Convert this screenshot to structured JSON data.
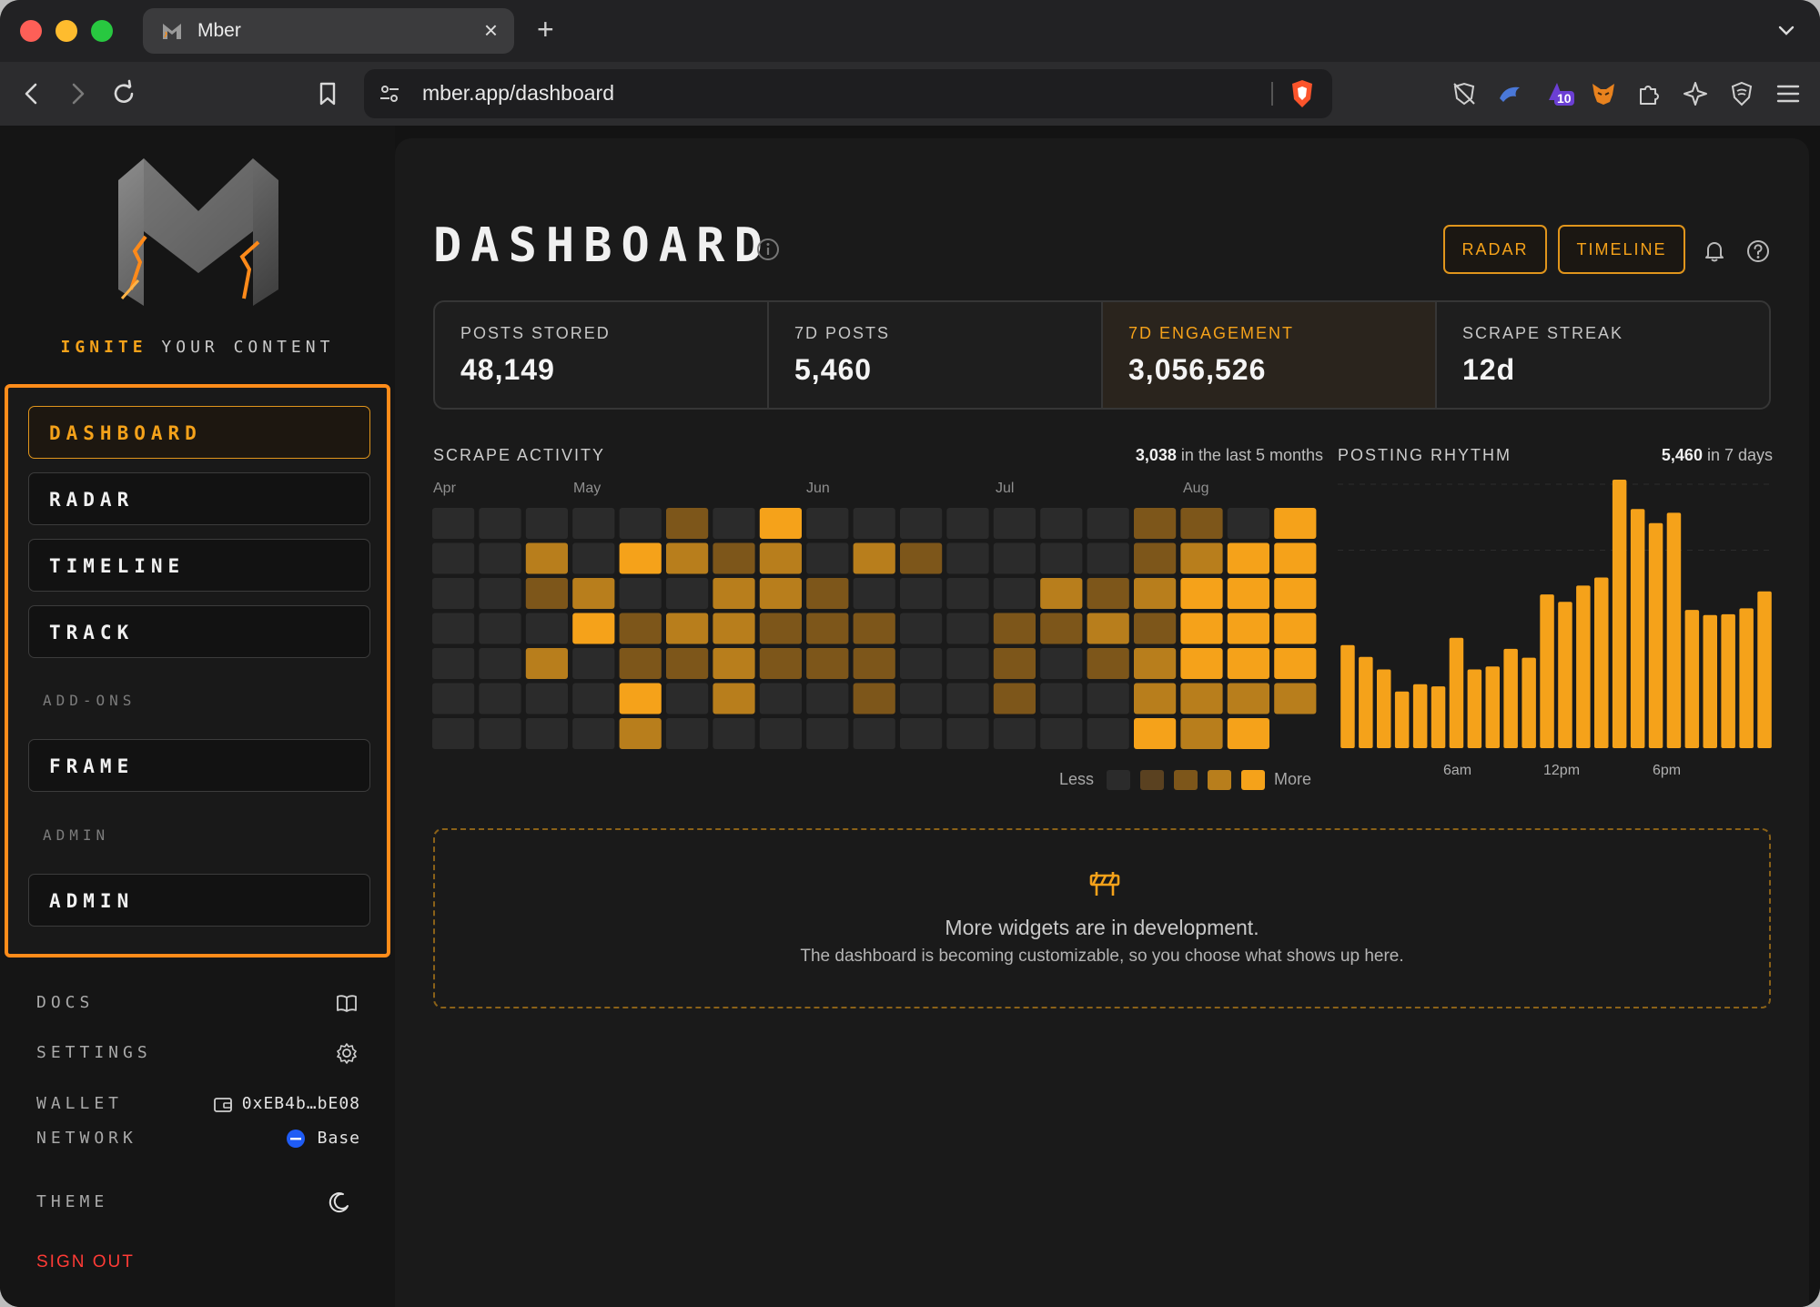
{
  "browser": {
    "tab_title": "Mber",
    "url": "mber.app/dashboard",
    "extension_badge": "10"
  },
  "sidebar": {
    "tagline_hot": "IGNITE",
    "tagline_rest": " YOUR CONTENT",
    "nav": [
      {
        "label": "DASHBOARD",
        "active": true
      },
      {
        "label": "RADAR"
      },
      {
        "label": "TIMELINE"
      },
      {
        "label": "TRACK"
      }
    ],
    "addons_heading": "ADD-ONS",
    "addons": [
      {
        "label": "FRAME"
      }
    ],
    "admin_heading": "ADMIN",
    "admin": [
      {
        "label": "ADMIN"
      }
    ],
    "docs_label": "DOCS",
    "settings_label": "SETTINGS",
    "wallet_label": "WALLET",
    "wallet_value": "0xEB4b…bE08",
    "network_label": "NETWORK",
    "network_value": "Base",
    "theme_label": "THEME",
    "signout_label": "SIGN OUT"
  },
  "header": {
    "title": "DASHBOARD",
    "radar_button": "RADAR",
    "timeline_button": "TIMELINE"
  },
  "stats": [
    {
      "label": "POSTS STORED",
      "value": "48,149"
    },
    {
      "label": "7D POSTS",
      "value": "5,460"
    },
    {
      "label": "7D ENGAGEMENT",
      "value": "3,056,526",
      "highlighted": true
    },
    {
      "label": "SCRAPE STREAK",
      "value": "12d"
    }
  ],
  "scrape_activity": {
    "title": "SCRAPE ACTIVITY",
    "count": "3,038",
    "count_suffix": " in the last 5 months",
    "months": [
      "Apr",
      "May",
      "Jun",
      "Jul",
      "Aug"
    ],
    "legend_less": "Less",
    "legend_more": "More",
    "level_colors": [
      "#2b2b2b",
      "#5a4120",
      "#7d561a",
      "#b87e1c",
      "#f5a21a"
    ],
    "levels_by_week": [
      [
        0,
        0,
        0,
        0,
        0,
        0,
        0
      ],
      [
        0,
        0,
        0,
        0,
        0,
        0,
        0
      ],
      [
        0,
        3,
        2,
        0,
        3,
        0,
        0
      ],
      [
        0,
        0,
        3,
        4,
        0,
        0,
        0
      ],
      [
        0,
        4,
        0,
        2,
        2,
        4,
        3
      ],
      [
        2,
        3,
        0,
        3,
        2,
        0,
        0
      ],
      [
        0,
        2,
        3,
        3,
        3,
        3,
        0
      ],
      [
        4,
        3,
        3,
        2,
        2,
        0,
        0
      ],
      [
        0,
        0,
        2,
        2,
        2,
        0,
        0
      ],
      [
        0,
        3,
        0,
        2,
        2,
        2,
        0
      ],
      [
        0,
        2,
        0,
        0,
        0,
        0,
        0
      ],
      [
        0,
        0,
        0,
        0,
        0,
        0,
        0
      ],
      [
        0,
        0,
        0,
        2,
        2,
        2,
        0
      ],
      [
        0,
        0,
        3,
        2,
        0,
        0,
        0
      ],
      [
        0,
        0,
        2,
        3,
        2,
        0,
        0
      ],
      [
        2,
        2,
        3,
        2,
        3,
        3,
        4
      ],
      [
        2,
        3,
        4,
        4,
        4,
        3,
        3
      ],
      [
        0,
        4,
        4,
        4,
        4,
        3,
        4
      ],
      [
        4,
        4,
        4,
        4,
        4,
        3,
        null
      ]
    ]
  },
  "posting_rhythm": {
    "title": "POSTING RHYTHM",
    "count": "5,460",
    "count_suffix": " in 7 days",
    "hour_labels": [
      "6am",
      "12pm",
      "6pm"
    ],
    "bar_color": "#f5a21a",
    "chart_data": {
      "type": "bar",
      "x": [
        0,
        1,
        2,
        3,
        4,
        5,
        6,
        7,
        8,
        9,
        10,
        11,
        12,
        13,
        14,
        15,
        16,
        17,
        18,
        19,
        20,
        21,
        22,
        23
      ],
      "values": [
        140,
        124,
        107,
        77,
        87,
        84,
        150,
        107,
        111,
        135,
        123,
        209,
        199,
        221,
        232,
        365,
        325,
        306,
        320,
        188,
        181,
        182,
        190,
        213
      ]
    }
  },
  "wip": {
    "title": "More widgets are in development.",
    "subtitle": "The dashboard is becoming customizable, so you choose what shows up here."
  }
}
